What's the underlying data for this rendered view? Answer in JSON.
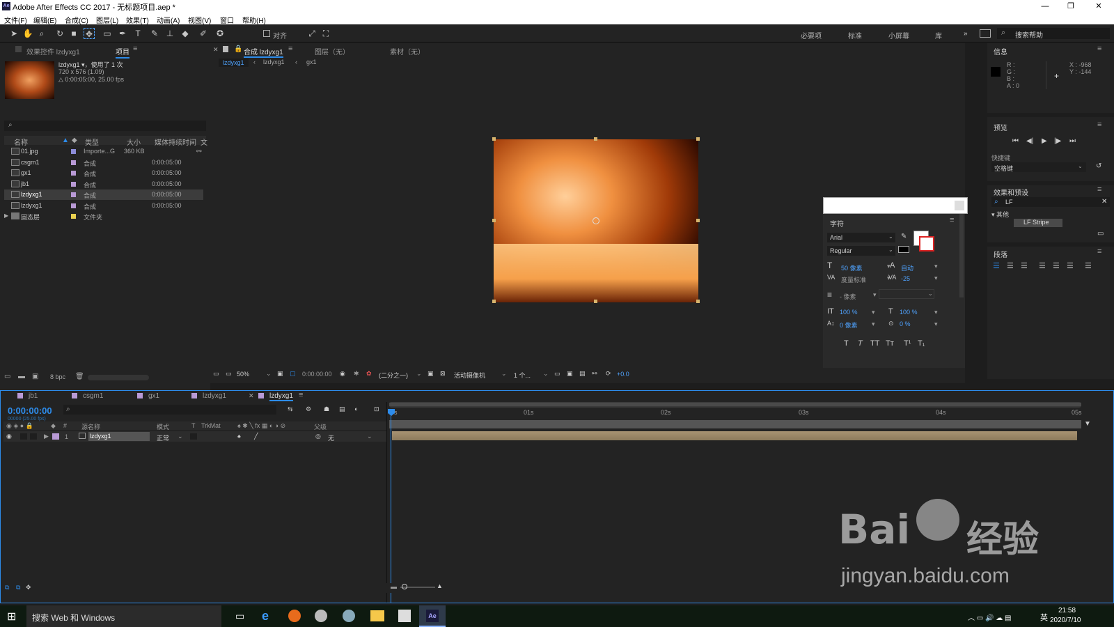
{
  "app": {
    "title": "Adobe After Effects CC 2017 - 无标题项目.aep *",
    "logo": "Ae"
  },
  "menu": [
    "文件(F)",
    "编辑(E)",
    "合成(C)",
    "图层(L)",
    "效果(T)",
    "动画(A)",
    "视图(V)",
    "窗口",
    "帮助(H)"
  ],
  "toolbar": {
    "snap_label": "对齐",
    "workspaces": [
      "必要项",
      "标准",
      "小屏幕",
      "库"
    ],
    "search_help": "搜索帮助"
  },
  "project": {
    "tab_effects": "效果控件 lzdyxg1",
    "tab_project": "项目",
    "item_name": "lzdyxg1 ▾，使用了 1 次",
    "item_size": "720 x 576 (1.09)",
    "item_duration": "△ 0:00:05:00, 25.00 fps",
    "search_placeholder": "",
    "columns": [
      "名称",
      "类型",
      "大小",
      "媒体持续时间",
      "文"
    ],
    "rows": [
      {
        "name": "01.jpg",
        "type": "Importe...G",
        "size": "360 KB",
        "duration": "",
        "color": "#8c8cd8"
      },
      {
        "name": "csgm1",
        "type": "合成",
        "size": "",
        "duration": "0:00:05:00",
        "color": "#b99ad6"
      },
      {
        "name": "gx1",
        "type": "合成",
        "size": "",
        "duration": "0:00:05:00",
        "color": "#b99ad6"
      },
      {
        "name": "jb1",
        "type": "合成",
        "size": "",
        "duration": "0:00:05:00",
        "color": "#b99ad6"
      },
      {
        "name": "lzdyxg1",
        "type": "合成",
        "size": "",
        "duration": "0:00:05:00",
        "color": "#b99ad6"
      },
      {
        "name": "lzdyxg1",
        "type": "合成",
        "size": "",
        "duration": "0:00:05:00",
        "color": "#b99ad6"
      },
      {
        "name": "固态层",
        "type": "文件夹",
        "size": "",
        "duration": "",
        "color": "#e8d050"
      }
    ],
    "bpc": "8 bpc"
  },
  "comp": {
    "tab_comp": "合成 lzdyxg1",
    "tab_layer": "图层（无）",
    "tab_footage": "素材（无）",
    "crumbs": [
      "lzdyxg1",
      "lzdyxg1",
      "gx1"
    ],
    "zoom": "50%",
    "time": "0:00:00:00",
    "resolution": "(二分之一)",
    "camera": "活动摄像机",
    "views": "1 个...",
    "exposure": "+0.0"
  },
  "character": {
    "title": "字符",
    "font": "Arial",
    "style": "Regular",
    "size": "50 像素",
    "leading": "自动",
    "kerning": "度量标准",
    "tracking": "-25",
    "stroke": "- 像素",
    "vscale": "100 %",
    "hscale": "100 %",
    "baseline": "0 像素",
    "tsume": "0 %",
    "styles": [
      "T",
      "T",
      "TT",
      "Tт",
      "T¹",
      "T₁"
    ]
  },
  "info": {
    "title": "信息",
    "r": "R :",
    "g": "G :",
    "b": "B :",
    "a": "A : 0",
    "x": "X : -968",
    "y": "Y : -144"
  },
  "preview": {
    "title": "预览",
    "shortcut_label": "快捷键",
    "shortcut": "空格键"
  },
  "effects": {
    "title": "效果和预设",
    "search": "LF",
    "group": "▾ 其他",
    "item": "LF Stripe"
  },
  "paragraph": {
    "title": "段落"
  },
  "timeline": {
    "tabs": [
      "jb1",
      "csgm1",
      "gx1",
      "lzdyxg1",
      "lzdyxg1"
    ],
    "time": "0:00:00:00",
    "frames": "00000 (25.00 fps)",
    "cols": [
      "#",
      "源名称",
      "模式",
      "T",
      "TrkMat",
      "父级"
    ],
    "layer": {
      "num": "1",
      "name": "lzdyxg1",
      "mode": "正常",
      "parent": "无"
    },
    "ruler": [
      "0s",
      "01s",
      "02s",
      "03s",
      "04s",
      "05s"
    ]
  },
  "taskbar": {
    "search": "搜索 Web 和 Windows",
    "time": "21:58",
    "date": "2020/7/10",
    "ime": "英"
  },
  "watermark": {
    "text1": "Bai",
    "text2": "经验",
    "url": "jingyan.baidu.com"
  },
  "colors": {
    "accent": "#2d8ceb",
    "panel": "#232323",
    "bg": "#1d1d1d"
  }
}
